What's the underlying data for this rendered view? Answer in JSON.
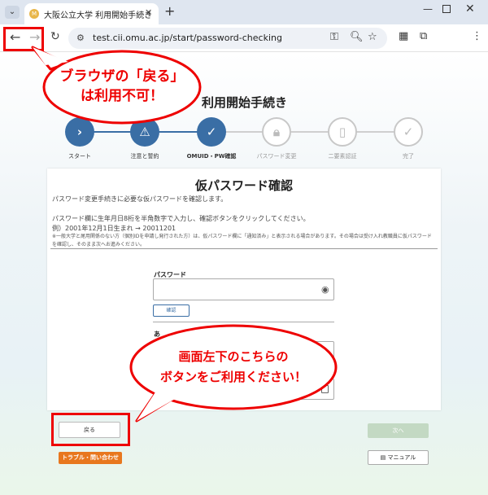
{
  "browser": {
    "tab_menu_icon": "chevron-down-icon",
    "tab_title": "大阪公立大学 利用開始手続き",
    "tab_close": "✕",
    "new_tab": "+",
    "url": "test.cii.omu.ac.jp/start/password-checking"
  },
  "page": {
    "title": "利用開始手続き"
  },
  "steps": [
    {
      "label": "スタート",
      "state": "done",
      "icon": "chevron-right-icon"
    },
    {
      "label": "注意と誓約",
      "state": "done",
      "icon": "warning-icon"
    },
    {
      "label": "OMUID・PW確認",
      "state": "current",
      "icon": "user-check-icon"
    },
    {
      "label": "パスワード変更",
      "state": "todo",
      "icon": "lock-icon"
    },
    {
      "label": "二要素認証",
      "state": "todo",
      "icon": "phone-icon"
    },
    {
      "label": "完了",
      "state": "todo",
      "icon": "check-icon"
    }
  ],
  "card": {
    "title": "仮パスワード確認",
    "intro": "パスワード変更手続きに必要な仮パスワードを確認します。",
    "instruction": "パスワード欄に生年月日8桁を半角数字で入力し、確認ボタンをクリックしてください。",
    "example": "例）2001年12月1日生まれ → 20011201",
    "note": "※一般大学と尾用関係のない方（個別IDを申請し発行された方）は、仮パスワード欄に「通知済み」と表示される場合があります。その場合は受け入れ教職員に仮パスワードを確認し、そのまま次へお進みください。",
    "password_label": "パスワード",
    "confirm_label": "確認",
    "field2_partial_label": "あ"
  },
  "buttons": {
    "back": "戻る",
    "next": "次へ",
    "trouble": "トラブル・問い合わせ",
    "manual": "マニュアル"
  },
  "annotations": {
    "bubble1_line1": "ブラウザの「戻る」",
    "bubble1_line2": "は利用不可！",
    "bubble2_line1": "画面左下のこちらの",
    "bubble2_line2": "ボタンをご利用ください！",
    "color": "#e00000"
  }
}
